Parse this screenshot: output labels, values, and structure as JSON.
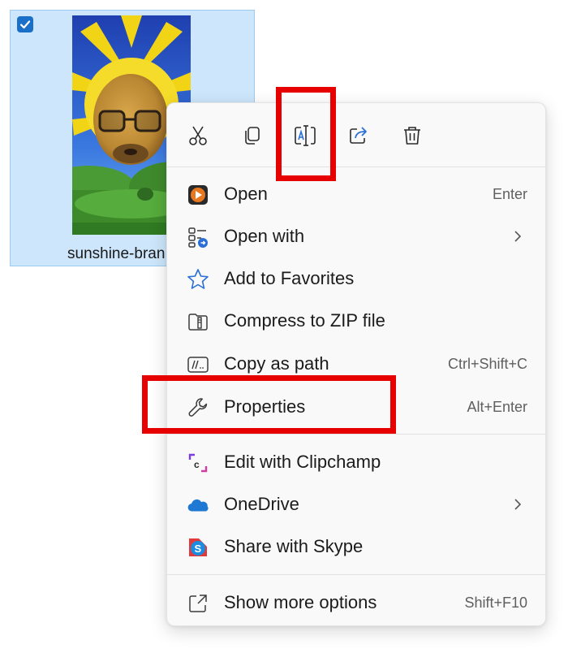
{
  "file": {
    "name": "sunshine-bran",
    "selected": true
  },
  "toolbar": {
    "buttons": [
      {
        "name": "Cut",
        "icon": "scissors-icon"
      },
      {
        "name": "Copy",
        "icon": "copy-icon"
      },
      {
        "name": "Rename",
        "icon": "rename-icon"
      },
      {
        "name": "Share",
        "icon": "share-icon"
      },
      {
        "name": "Delete",
        "icon": "trash-icon"
      }
    ]
  },
  "menu": {
    "items": [
      {
        "label": "Open",
        "shortcut": "Enter",
        "icon": "media-player-icon"
      },
      {
        "label": "Open with",
        "shortcut": "",
        "icon": "open-with-icon",
        "submenu": true
      },
      {
        "label": "Add to Favorites",
        "shortcut": "",
        "icon": "star-icon"
      },
      {
        "label": "Compress to ZIP file",
        "shortcut": "",
        "icon": "zip-icon"
      },
      {
        "label": "Copy as path",
        "shortcut": "Ctrl+Shift+C",
        "icon": "path-icon"
      },
      {
        "label": "Properties",
        "shortcut": "Alt+Enter",
        "icon": "wrench-icon"
      },
      {
        "label": "Edit with Clipchamp",
        "shortcut": "",
        "icon": "clipchamp-icon"
      },
      {
        "label": "OneDrive",
        "shortcut": "",
        "icon": "onedrive-icon",
        "submenu": true
      },
      {
        "label": "Share with Skype",
        "shortcut": "",
        "icon": "skype-icon"
      },
      {
        "label": "Show more options",
        "shortcut": "Shift+F10",
        "icon": "more-options-icon"
      }
    ]
  },
  "colors": {
    "highlight": "#e60000",
    "selection": "#cde6fb",
    "accent": "#1a6fc9"
  }
}
